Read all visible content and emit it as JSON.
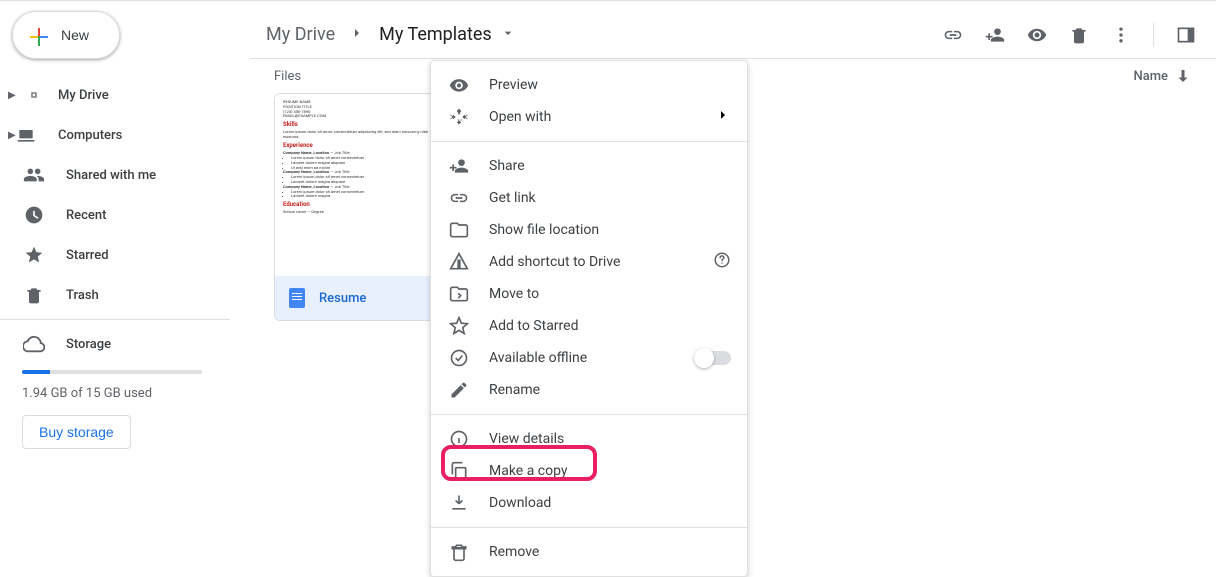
{
  "new_label": "New",
  "sidebar": {
    "my_drive": "My Drive",
    "computers": "Computers",
    "shared": "Shared with me",
    "recent": "Recent",
    "starred": "Starred",
    "trash": "Trash",
    "storage": "Storage",
    "storage_used": "1.94 GB of 15 GB used",
    "buy": "Buy storage"
  },
  "breadcrumb": {
    "root": "My Drive",
    "current": "My Templates"
  },
  "sort": {
    "files_label": "Files",
    "name_label": "Name"
  },
  "file": {
    "name": "Resume"
  },
  "menu": {
    "preview": "Preview",
    "open_with": "Open with",
    "share": "Share",
    "get_link": "Get link",
    "show_location": "Show file location",
    "add_shortcut": "Add shortcut to Drive",
    "move_to": "Move to",
    "add_starred": "Add to Starred",
    "offline": "Available offline",
    "rename": "Rename",
    "view_details": "View details",
    "make_copy": "Make a copy",
    "download": "Download",
    "remove": "Remove"
  }
}
